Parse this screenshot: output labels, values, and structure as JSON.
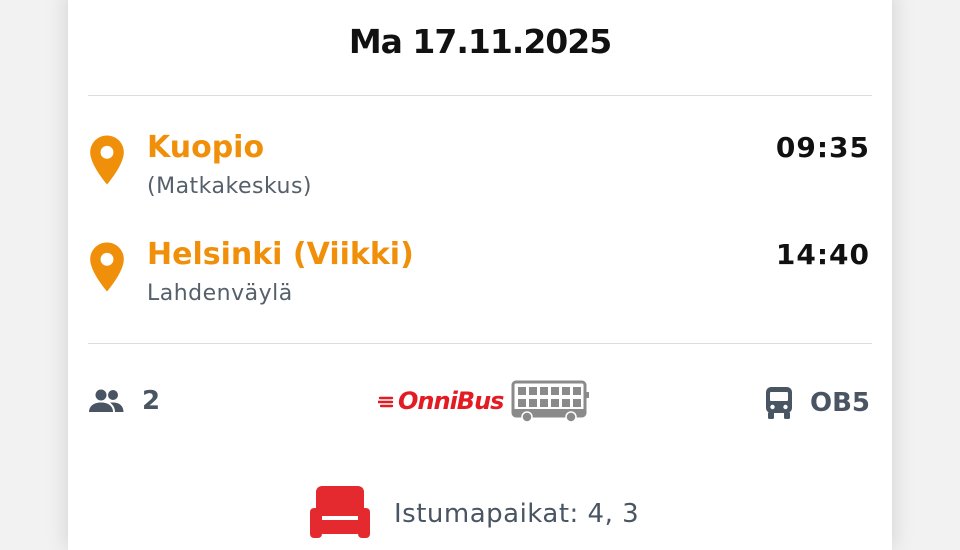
{
  "trip": {
    "date": "Ma 17.11.2025",
    "origin": {
      "name": "Kuopio",
      "detail": "(Matkakeskus)",
      "time": "09:35"
    },
    "destination": {
      "name": "Helsinki (Viikki)",
      "detail": "Lahdenväylä",
      "time": "14:40"
    },
    "passengers": "2",
    "operator": "OnniBus",
    "line": "OB5",
    "seats": "Istumapaikat: 4, 3"
  },
  "colors": {
    "accent": "#f0900a",
    "brand": "#e31b23",
    "muted": "#4a5563",
    "seat_red": "#e52a2f"
  },
  "icons": {
    "pin": "map-pin-icon",
    "passengers": "people-icon",
    "bus": "bus-icon",
    "double_decker": "double-decker-bus-icon",
    "seat": "seat-icon"
  }
}
